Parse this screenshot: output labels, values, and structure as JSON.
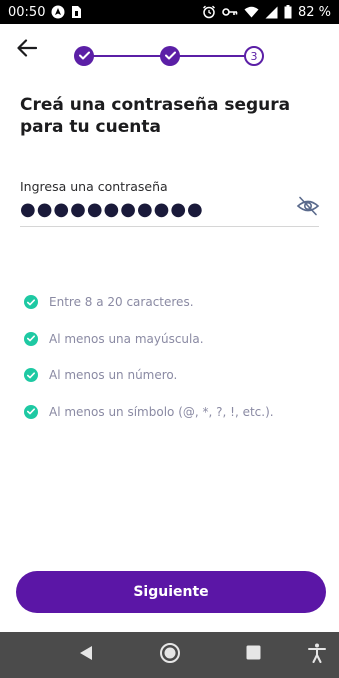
{
  "status_bar": {
    "time": "00:50",
    "battery": "82 %",
    "icons": [
      "navigation-icon",
      "sim-icon",
      "alarm-icon",
      "vpn-key-icon",
      "wifi-icon",
      "signal-icon",
      "battery-icon"
    ]
  },
  "header": {
    "back_icon": "arrow-left-icon",
    "stepper": {
      "steps": [
        {
          "state": "done",
          "label": ""
        },
        {
          "state": "done",
          "label": ""
        },
        {
          "state": "current",
          "label": "3"
        }
      ]
    }
  },
  "main": {
    "title": "Creá una contraseña segura para tu cuenta",
    "password_field": {
      "label": "Ingresa una contraseña",
      "value": "●●●●●●●●●●●",
      "toggle_icon": "eye-off-icon"
    },
    "requirements": [
      {
        "text": "Entre 8 a 20 caracteres.",
        "met": true
      },
      {
        "text": "Al menos una mayúscula.",
        "met": true
      },
      {
        "text": "Al menos un número.",
        "met": true
      },
      {
        "text": "Al menos un símbolo (@, *, ?, !, etc.).",
        "met": true
      }
    ]
  },
  "footer": {
    "next_label": "Siguiente"
  },
  "nav_bar": {
    "buttons": [
      "back-triangle-icon",
      "home-circle-icon",
      "recents-square-icon",
      "accessibility-icon"
    ]
  },
  "colors": {
    "accent": "#5b16a6",
    "check": "#1ec9a3",
    "requirement_text": "#8a8aa3",
    "nav_bar": "#4b4b4b"
  }
}
